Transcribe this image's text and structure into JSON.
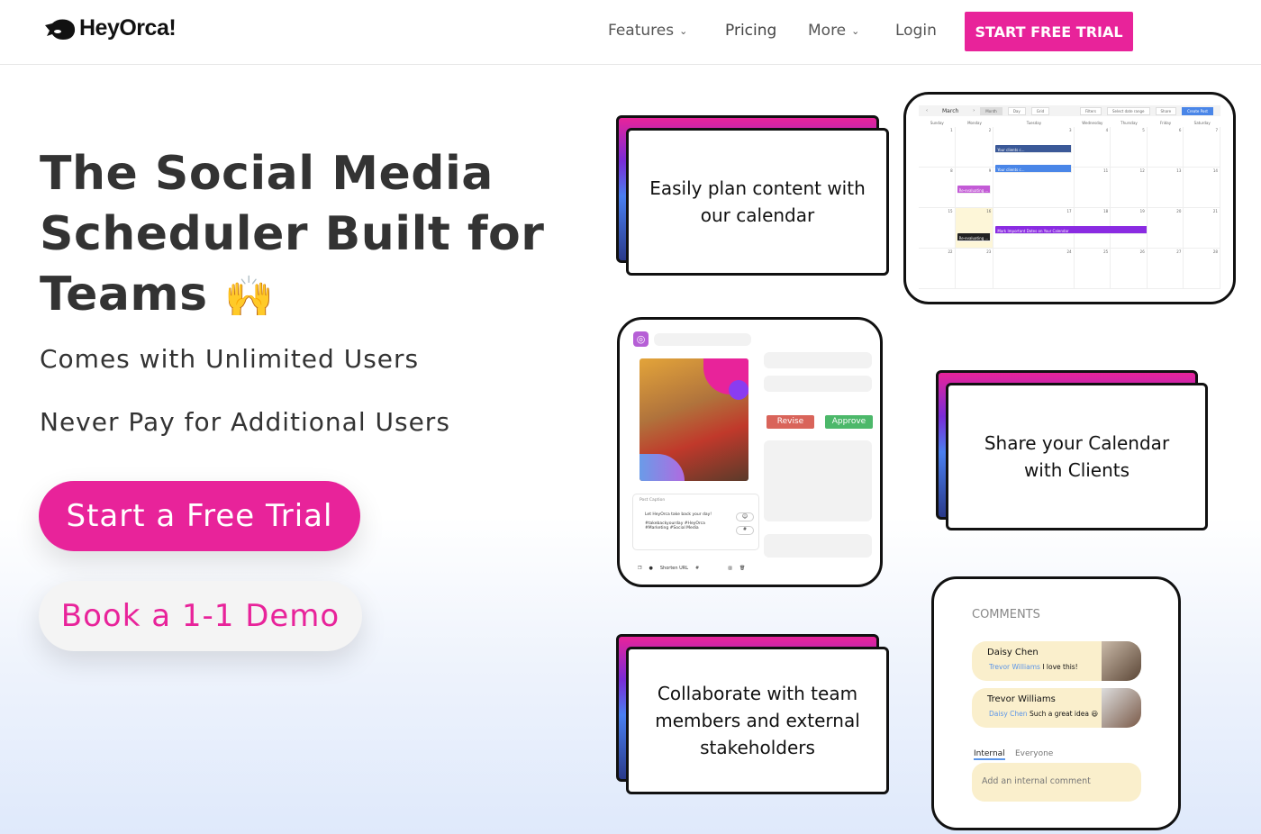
{
  "nav": {
    "logo": "HeyOrca!",
    "items": [
      {
        "label": "Features",
        "dropdown": true
      },
      {
        "label": "Pricing",
        "dropdown": false
      },
      {
        "label": "More",
        "dropdown": true
      },
      {
        "label": "Login",
        "dropdown": false
      }
    ],
    "cta": "START FREE TRIAL"
  },
  "hero": {
    "title": "The Social Media Scheduler Built for Teams",
    "emoji": "🙌",
    "subtitle1": "Comes with Unlimited Users",
    "subtitle2": "Never Pay for Additional Users",
    "primary_button": "Start a Free Trial",
    "secondary_button": "Book a 1-1 Demo"
  },
  "cards": {
    "plan": "Easily plan content with our calendar",
    "share": "Share your Calendar with Clients",
    "collab": "Collaborate with team members and external stakeholders"
  },
  "calendar": {
    "month": "March",
    "views": [
      "Month",
      "Day",
      "Grid"
    ],
    "filters": "Filters",
    "stage": "Select date range",
    "share": "Share",
    "create": "Create Post",
    "days": [
      "Sunday",
      "Monday",
      "Tuesday",
      "Wednesday",
      "Thursday",
      "Friday",
      "Saturday"
    ],
    "dates": [
      "1",
      "2",
      "3",
      "4",
      "5",
      "6",
      "7",
      "8",
      "9",
      "10",
      "11",
      "12",
      "13",
      "14",
      "15",
      "16",
      "17",
      "18",
      "19",
      "20",
      "21",
      "22",
      "23",
      "24",
      "25",
      "26",
      "27",
      "28"
    ],
    "events": [
      {
        "label": "Your clients c...",
        "color": "#3b5998"
      },
      {
        "label": "Your clients c...",
        "color": "#4a86e8"
      },
      {
        "label": "Re-evaluating ...",
        "color": "#c35bd6"
      },
      {
        "label": "Mark Important Dates on Your Calendar",
        "color": "#8a2be2"
      },
      {
        "label": "Re-evaluating ...",
        "color": "#222222"
      }
    ]
  },
  "post": {
    "revise": "Revise",
    "approve": "Approve",
    "caption_label": "Post Caption",
    "caption": "Let HeyOrca take back your day!",
    "hashtags": "#takebackyourday #HeyOrca #Marketing #Social Media",
    "shorten": "Shorten URL"
  },
  "comments": {
    "title": "COMMENTS",
    "items": [
      {
        "name": "Daisy Chen",
        "mention": "Trevor Williams",
        "text": "I love this!"
      },
      {
        "name": "Trevor Williams",
        "mention": "Daisy Chen",
        "text": "Such a great idea 😃"
      }
    ],
    "tabs": [
      "Internal",
      "Everyone"
    ],
    "placeholder": "Add an internal comment"
  },
  "colors": {
    "brand": "#e8239a",
    "revise": "#d9645a",
    "approve": "#4cb86a",
    "comment_bg": "#faefcc"
  }
}
